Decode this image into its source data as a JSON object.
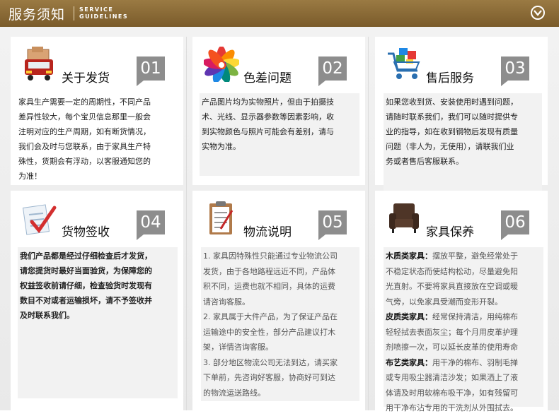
{
  "header": {
    "title": "服务须知",
    "en_line1": "SERVICE",
    "en_line2": "GUIDELINES"
  },
  "cards": [
    {
      "title": "关于发货",
      "number": "01",
      "icon": "delivery-truck-icon",
      "lines": [
        "家具生产需要一定的周期性，不同产品",
        "差异性较大，每个宝贝信息那里一般会",
        "注明对应的生产周期，如有断货情况，",
        "我们会及时与您联系，由于家具生产特",
        "殊性，货期会有浮动，以客服通知您的",
        "为准！"
      ]
    },
    {
      "title": "色差问题",
      "number": "02",
      "icon": "color-wheel-icon",
      "lines": [
        "产品图片均为实物照片，但由于拍摄技",
        "术、光线、显示器参数等因素影响，收",
        "到实物颜色与照片可能会有差别，请与",
        "实物为准。"
      ]
    },
    {
      "title": "售后服务",
      "number": "03",
      "icon": "shopping-cart-icon",
      "lines": [
        "如果您收到货、安装使用时遇到问题，",
        "请随时联系我们，我们可以随时提供专",
        "业的指导，如在收到钢物后发现有质量",
        "问题（非人为，无使用），请联我们业",
        "务或者售后客服联系。"
      ]
    },
    {
      "title": "货物签收",
      "number": "04",
      "icon": "checklist-icon",
      "lines": [
        "我们产品都是经过仔细检查后才发货，",
        "请您提货时最好当面验货，为保障您的",
        "权益签收前请仔细，检查验货时发现有",
        "数目不对或者运输损坏，请不予签收并",
        "及时联系我们。"
      ]
    },
    {
      "title": "物流说明",
      "number": "05",
      "icon": "clipboard-icon",
      "lines": [
        "1. 家具因特殊性只能通过专业物流公司",
        "发货，由于各地路程远近不同，产品体",
        "积不同，运费也就不相同，具体的运费",
        "请咨询客服。",
        "2. 家具属于大件产品，为了保证产品在",
        "运输途中的安全性，部分产品建议打木",
        "架，详情咨询客服。",
        "3. 部分地区物流公司无法到达，请买家",
        "下单前，先咨询好客服，协商好可到达",
        "的物流运送路线。"
      ]
    },
    {
      "title": "家具保养",
      "number": "06",
      "icon": "armchair-icon",
      "care": [
        {
          "label": "木质类家具：",
          "lines": [
            "摆放平整，避免经常处于",
            "不稳定状态而使结构松动，尽量避免阳",
            "光直射。不要将家具直接放在空调或暖",
            "气旁，以免家具受潮而变形开裂。"
          ]
        },
        {
          "label": "皮质类家具：",
          "lines": [
            "经常保持清洁，用纯棉布",
            "轻轻拭去表面灰尘；每个月用皮革护理",
            "剂喷擦一次，可以延长皮革的使用寿命"
          ]
        },
        {
          "label": "布艺类家具：",
          "lines": [
            "用干净的棉布、羽制毛掸",
            "或专用吸尘器清洁沙发；如果洒上了液",
            "体请及时用软棉布吸干净，如有残留可",
            "用干净布沾专用的干洗剂从外围拭去。"
          ]
        }
      ]
    }
  ]
}
